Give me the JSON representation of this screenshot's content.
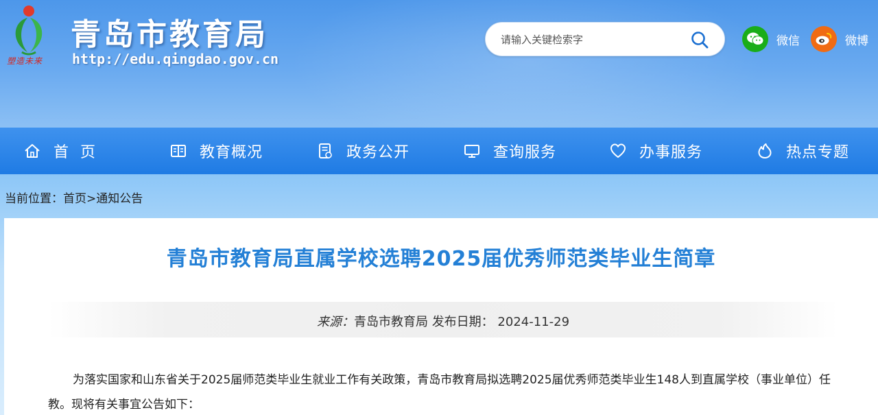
{
  "header": {
    "title": "青岛市教育局",
    "url": "http://edu.qingdao.gov.cn",
    "emblem_motto": "塑造未来",
    "search": {
      "placeholder": "请输入关键检索字",
      "value": ""
    },
    "social": [
      {
        "label": "微信",
        "icon": "wechat-icon",
        "color": "#1aad19"
      },
      {
        "label": "微博",
        "icon": "weibo-icon",
        "color": "#f06b14"
      }
    ]
  },
  "nav": [
    {
      "label": "首  页",
      "icon": "home-icon"
    },
    {
      "label": "教育概况",
      "icon": "book-icon"
    },
    {
      "label": "政务公开",
      "icon": "document-icon"
    },
    {
      "label": "查询服务",
      "icon": "monitor-icon"
    },
    {
      "label": "办事服务",
      "icon": "heart-icon"
    },
    {
      "label": "热点专题",
      "icon": "flame-icon"
    }
  ],
  "breadcrumb": {
    "prefix": "当前位置：",
    "home": "首页",
    "sep": ">",
    "current": "通知公告"
  },
  "article": {
    "title": "青岛市教育局直属学校选聘2025届优秀师范类毕业生简章",
    "source_label": "来源：",
    "source": "青岛市教育局",
    "date_label": "发布日期：",
    "date": "2024-11-29",
    "paragraph": "为落实国家和山东省关于2025届师范类毕业生就业工作有关政策，青岛市教育局拟选聘2025届优秀师范类毕业生148人到直属学校（事业单位）任教。现将有关事宜公告如下："
  },
  "colors": {
    "accent": "#2480d6",
    "nav": "#1f7be4",
    "header": "#5a9eec"
  }
}
